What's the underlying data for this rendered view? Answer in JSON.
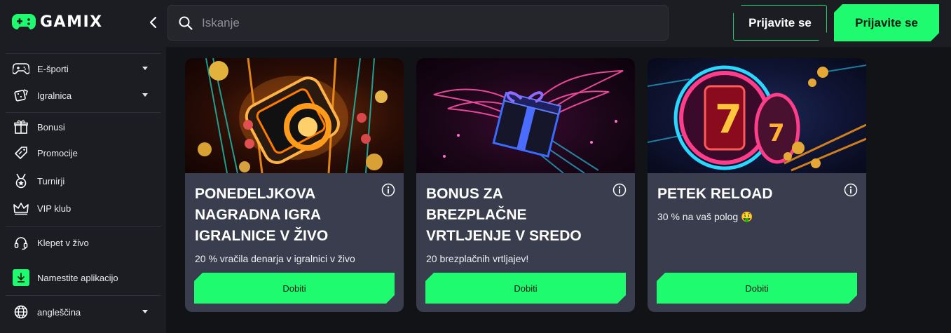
{
  "brand": {
    "name": "GAMIX",
    "accent": "#1efb6f"
  },
  "sidebar": {
    "items": [
      {
        "label": "E-športi",
        "icon": "gamepad-icon",
        "caret": true
      },
      {
        "label": "Igralnica",
        "icon": "dice-icon",
        "caret": true
      },
      {
        "label": "Bonusi",
        "icon": "gift-icon",
        "caret": false
      },
      {
        "label": "Promocije",
        "icon": "tag-icon",
        "caret": false
      },
      {
        "label": "Turnirji",
        "icon": "medal-icon",
        "caret": false
      },
      {
        "label": "VIP klub",
        "icon": "crown-icon",
        "caret": false
      },
      {
        "label": "Klepet v živo",
        "icon": "headset-icon",
        "caret": false
      },
      {
        "label": "Namestite aplikacijo",
        "icon": "download-icon",
        "caret": false
      },
      {
        "label": "angleščina",
        "icon": "globe-icon",
        "caret": true
      }
    ]
  },
  "header": {
    "search_placeholder": "Iskanje",
    "login_label": "Prijavite se",
    "register_label": "Prijavite se"
  },
  "promos": [
    {
      "title": "PONEDELJKOVA NAGRADNA IGRA IGRALNICE V ŽIVO",
      "description": "20 % vračila denarja v igralnici v živo",
      "button": "Dobiti"
    },
    {
      "title": "BONUS ZA BREZPLAČNE VRTLJENJE V SREDO",
      "description": "20 brezplačnih vrtljajev!",
      "button": "Dobiti"
    },
    {
      "title": "PETEK RELOAD",
      "description": "30 % na vaš polog 🤑",
      "button": "Dobiti"
    }
  ]
}
